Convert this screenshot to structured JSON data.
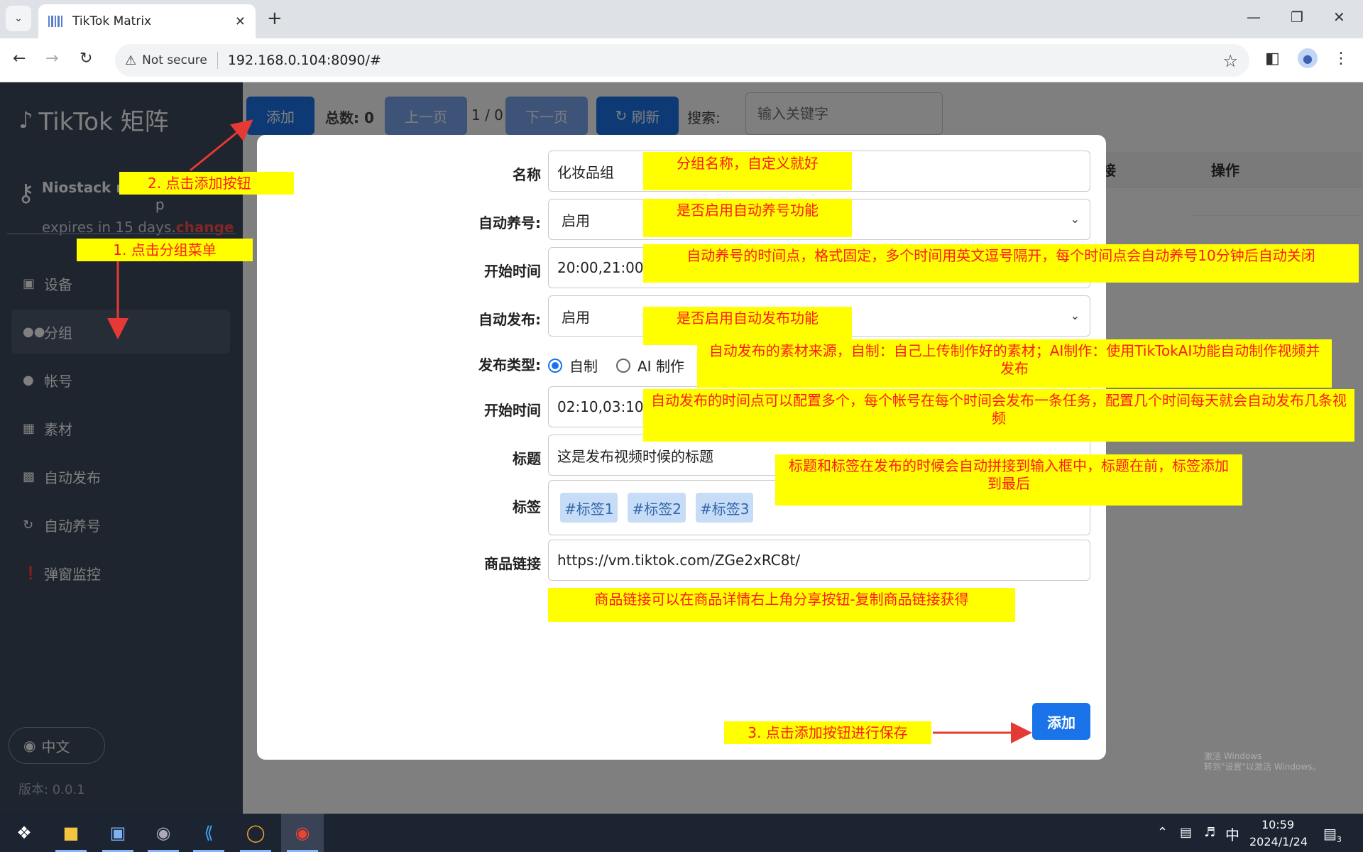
{
  "browser": {
    "tab_title": "TikTok Matrix",
    "new_tab_symbol": "+",
    "not_secure": "Not secure",
    "url": "192.168.0.104:8090/#"
  },
  "sidebar": {
    "logo": "TikTok 矩阵",
    "license_name": "Niostack n",
    "license_name_suffix": "p",
    "license_expiry": "expires in 15 days.",
    "license_change": "change",
    "menu": [
      {
        "label": "设备",
        "icon": "laptop-icon"
      },
      {
        "label": "分组",
        "icon": "users-icon"
      },
      {
        "label": "帐号",
        "icon": "user-icon"
      },
      {
        "label": "素材",
        "icon": "image-icon"
      },
      {
        "label": "自动发布",
        "icon": "robot-icon"
      },
      {
        "label": "自动养号",
        "icon": "refresh-icon"
      },
      {
        "label": "弹窗监控",
        "icon": "alert-icon"
      }
    ],
    "language": "中文",
    "version": "版本: 0.0.1"
  },
  "toolbar": {
    "add": "添加",
    "total": "总数: 0",
    "prev": "上一页",
    "page": "1 / 0",
    "next": "下一页",
    "refresh": "刷新",
    "search_label": "搜索:",
    "search_placeholder": "输入关键字"
  },
  "table": {
    "col_link_partial": "接",
    "col_actions": "操作"
  },
  "form": {
    "name_label": "名称",
    "name_value": "化妆品组",
    "auto_nurture_label": "自动养号:",
    "auto_nurture_value": "启用",
    "nurture_time_label": "开始时间",
    "nurture_time_value": "20:00,21:00",
    "auto_publish_label": "自动发布:",
    "auto_publish_value": "启用",
    "publish_type_label": "发布类型:",
    "publish_type_self": "自制",
    "publish_type_ai": "AI 制作",
    "publish_time_label": "开始时间",
    "publish_time_value": "02:10,03:10",
    "title_label": "标题",
    "title_value": "这是发布视频时候的标题",
    "tags_label": "标签",
    "tags": [
      "#标签1",
      "#标签2",
      "#标签3"
    ],
    "product_link_label": "商品链接",
    "product_link_value": "https://vm.tiktok.com/ZGe2xRC8t/",
    "submit": "添加"
  },
  "annotations": {
    "step1": "1. 点击分组菜单",
    "step2": "2. 点击添加按钮",
    "step3": "3. 点击添加按钮进行保存",
    "name_hint": "分组名称，自定义就好",
    "nurture_hint": "是否启用自动养号功能",
    "nurture_time_hint": "自动养号的时间点，格式固定，多个时间用英文逗号隔开，每个时间点会自动养号10分钟后自动关闭",
    "publish_hint": "是否启用自动发布功能",
    "publish_type_hint": "自动发布的素材来源，自制：自己上传制作好的素材；AI制作：使用TikTokAI功能自动制作视频并发布",
    "publish_time_hint": "自动发布的时间点可以配置多个，每个帐号在每个时间会发布一条任务，配置几个时间每天就会自动发布几条视频",
    "title_tag_hint": "标题和标签在发布的时候会自动拼接到输入框中，标题在前，标签添加到最后",
    "link_hint": "商品链接可以在商品详情右上角分享按钮-复制商品链接获得"
  },
  "taskbar": {
    "time": "10:59",
    "date": "2024/1/24",
    "ime": "中",
    "notifications": "3",
    "watermark_line1": "激活 Windows",
    "watermark_line2": "转到\"设置\"以激活 Windows。"
  },
  "colors": {
    "sidebar_bg": "#3d4a5c",
    "primary": "#1a73e8",
    "annotation_bg": "#ffff00",
    "annotation_text": "#ff1a1a",
    "arrow": "#e53935"
  }
}
